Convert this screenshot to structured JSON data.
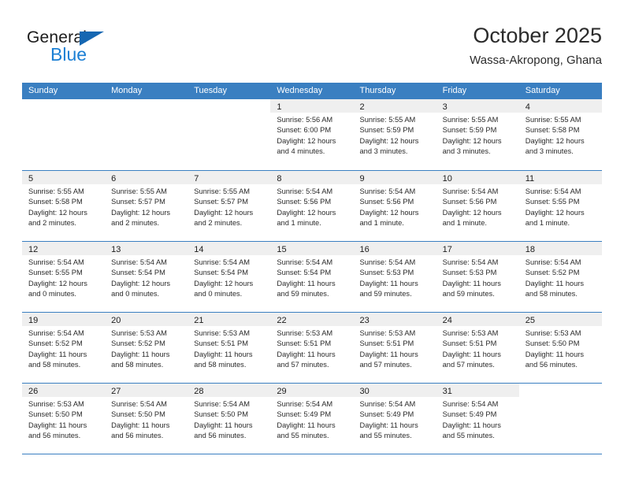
{
  "brand": {
    "name_part1": "General",
    "name_part2": "Blue",
    "triangle_color": "#1667b2",
    "blue_color": "#1b7fd4"
  },
  "header": {
    "title": "October 2025",
    "subtitle": "Wassa-Akropong, Ghana"
  },
  "theme": {
    "header_bg": "#3a7fc1",
    "day_strip_bg": "#efefef",
    "grid_line": "#3a7fc1",
    "text": "#2a2a2a"
  },
  "weekdays": [
    "Sunday",
    "Monday",
    "Tuesday",
    "Wednesday",
    "Thursday",
    "Friday",
    "Saturday"
  ],
  "weeks": [
    [
      {
        "date": "",
        "blank": true,
        "sunrise": "",
        "sunset": "",
        "daylight1": "",
        "daylight2": ""
      },
      {
        "date": "",
        "blank": true,
        "sunrise": "",
        "sunset": "",
        "daylight1": "",
        "daylight2": ""
      },
      {
        "date": "",
        "blank": true,
        "sunrise": "",
        "sunset": "",
        "daylight1": "",
        "daylight2": ""
      },
      {
        "date": "1",
        "sunrise": "Sunrise: 5:56 AM",
        "sunset": "Sunset: 6:00 PM",
        "daylight1": "Daylight: 12 hours",
        "daylight2": "and 4 minutes."
      },
      {
        "date": "2",
        "sunrise": "Sunrise: 5:55 AM",
        "sunset": "Sunset: 5:59 PM",
        "daylight1": "Daylight: 12 hours",
        "daylight2": "and 3 minutes."
      },
      {
        "date": "3",
        "sunrise": "Sunrise: 5:55 AM",
        "sunset": "Sunset: 5:59 PM",
        "daylight1": "Daylight: 12 hours",
        "daylight2": "and 3 minutes."
      },
      {
        "date": "4",
        "sunrise": "Sunrise: 5:55 AM",
        "sunset": "Sunset: 5:58 PM",
        "daylight1": "Daylight: 12 hours",
        "daylight2": "and 3 minutes."
      }
    ],
    [
      {
        "date": "5",
        "sunrise": "Sunrise: 5:55 AM",
        "sunset": "Sunset: 5:58 PM",
        "daylight1": "Daylight: 12 hours",
        "daylight2": "and 2 minutes."
      },
      {
        "date": "6",
        "sunrise": "Sunrise: 5:55 AM",
        "sunset": "Sunset: 5:57 PM",
        "daylight1": "Daylight: 12 hours",
        "daylight2": "and 2 minutes."
      },
      {
        "date": "7",
        "sunrise": "Sunrise: 5:55 AM",
        "sunset": "Sunset: 5:57 PM",
        "daylight1": "Daylight: 12 hours",
        "daylight2": "and 2 minutes."
      },
      {
        "date": "8",
        "sunrise": "Sunrise: 5:54 AM",
        "sunset": "Sunset: 5:56 PM",
        "daylight1": "Daylight: 12 hours",
        "daylight2": "and 1 minute."
      },
      {
        "date": "9",
        "sunrise": "Sunrise: 5:54 AM",
        "sunset": "Sunset: 5:56 PM",
        "daylight1": "Daylight: 12 hours",
        "daylight2": "and 1 minute."
      },
      {
        "date": "10",
        "sunrise": "Sunrise: 5:54 AM",
        "sunset": "Sunset: 5:56 PM",
        "daylight1": "Daylight: 12 hours",
        "daylight2": "and 1 minute."
      },
      {
        "date": "11",
        "sunrise": "Sunrise: 5:54 AM",
        "sunset": "Sunset: 5:55 PM",
        "daylight1": "Daylight: 12 hours",
        "daylight2": "and 1 minute."
      }
    ],
    [
      {
        "date": "12",
        "sunrise": "Sunrise: 5:54 AM",
        "sunset": "Sunset: 5:55 PM",
        "daylight1": "Daylight: 12 hours",
        "daylight2": "and 0 minutes."
      },
      {
        "date": "13",
        "sunrise": "Sunrise: 5:54 AM",
        "sunset": "Sunset: 5:54 PM",
        "daylight1": "Daylight: 12 hours",
        "daylight2": "and 0 minutes."
      },
      {
        "date": "14",
        "sunrise": "Sunrise: 5:54 AM",
        "sunset": "Sunset: 5:54 PM",
        "daylight1": "Daylight: 12 hours",
        "daylight2": "and 0 minutes."
      },
      {
        "date": "15",
        "sunrise": "Sunrise: 5:54 AM",
        "sunset": "Sunset: 5:54 PM",
        "daylight1": "Daylight: 11 hours",
        "daylight2": "and 59 minutes."
      },
      {
        "date": "16",
        "sunrise": "Sunrise: 5:54 AM",
        "sunset": "Sunset: 5:53 PM",
        "daylight1": "Daylight: 11 hours",
        "daylight2": "and 59 minutes."
      },
      {
        "date": "17",
        "sunrise": "Sunrise: 5:54 AM",
        "sunset": "Sunset: 5:53 PM",
        "daylight1": "Daylight: 11 hours",
        "daylight2": "and 59 minutes."
      },
      {
        "date": "18",
        "sunrise": "Sunrise: 5:54 AM",
        "sunset": "Sunset: 5:52 PM",
        "daylight1": "Daylight: 11 hours",
        "daylight2": "and 58 minutes."
      }
    ],
    [
      {
        "date": "19",
        "sunrise": "Sunrise: 5:54 AM",
        "sunset": "Sunset: 5:52 PM",
        "daylight1": "Daylight: 11 hours",
        "daylight2": "and 58 minutes."
      },
      {
        "date": "20",
        "sunrise": "Sunrise: 5:53 AM",
        "sunset": "Sunset: 5:52 PM",
        "daylight1": "Daylight: 11 hours",
        "daylight2": "and 58 minutes."
      },
      {
        "date": "21",
        "sunrise": "Sunrise: 5:53 AM",
        "sunset": "Sunset: 5:51 PM",
        "daylight1": "Daylight: 11 hours",
        "daylight2": "and 58 minutes."
      },
      {
        "date": "22",
        "sunrise": "Sunrise: 5:53 AM",
        "sunset": "Sunset: 5:51 PM",
        "daylight1": "Daylight: 11 hours",
        "daylight2": "and 57 minutes."
      },
      {
        "date": "23",
        "sunrise": "Sunrise: 5:53 AM",
        "sunset": "Sunset: 5:51 PM",
        "daylight1": "Daylight: 11 hours",
        "daylight2": "and 57 minutes."
      },
      {
        "date": "24",
        "sunrise": "Sunrise: 5:53 AM",
        "sunset": "Sunset: 5:51 PM",
        "daylight1": "Daylight: 11 hours",
        "daylight2": "and 57 minutes."
      },
      {
        "date": "25",
        "sunrise": "Sunrise: 5:53 AM",
        "sunset": "Sunset: 5:50 PM",
        "daylight1": "Daylight: 11 hours",
        "daylight2": "and 56 minutes."
      }
    ],
    [
      {
        "date": "26",
        "sunrise": "Sunrise: 5:53 AM",
        "sunset": "Sunset: 5:50 PM",
        "daylight1": "Daylight: 11 hours",
        "daylight2": "and 56 minutes."
      },
      {
        "date": "27",
        "sunrise": "Sunrise: 5:54 AM",
        "sunset": "Sunset: 5:50 PM",
        "daylight1": "Daylight: 11 hours",
        "daylight2": "and 56 minutes."
      },
      {
        "date": "28",
        "sunrise": "Sunrise: 5:54 AM",
        "sunset": "Sunset: 5:50 PM",
        "daylight1": "Daylight: 11 hours",
        "daylight2": "and 56 minutes."
      },
      {
        "date": "29",
        "sunrise": "Sunrise: 5:54 AM",
        "sunset": "Sunset: 5:49 PM",
        "daylight1": "Daylight: 11 hours",
        "daylight2": "and 55 minutes."
      },
      {
        "date": "30",
        "sunrise": "Sunrise: 5:54 AM",
        "sunset": "Sunset: 5:49 PM",
        "daylight1": "Daylight: 11 hours",
        "daylight2": "and 55 minutes."
      },
      {
        "date": "31",
        "sunrise": "Sunrise: 5:54 AM",
        "sunset": "Sunset: 5:49 PM",
        "daylight1": "Daylight: 11 hours",
        "daylight2": "and 55 minutes."
      },
      {
        "date": "",
        "blank": true,
        "sunrise": "",
        "sunset": "",
        "daylight1": "",
        "daylight2": ""
      }
    ]
  ]
}
